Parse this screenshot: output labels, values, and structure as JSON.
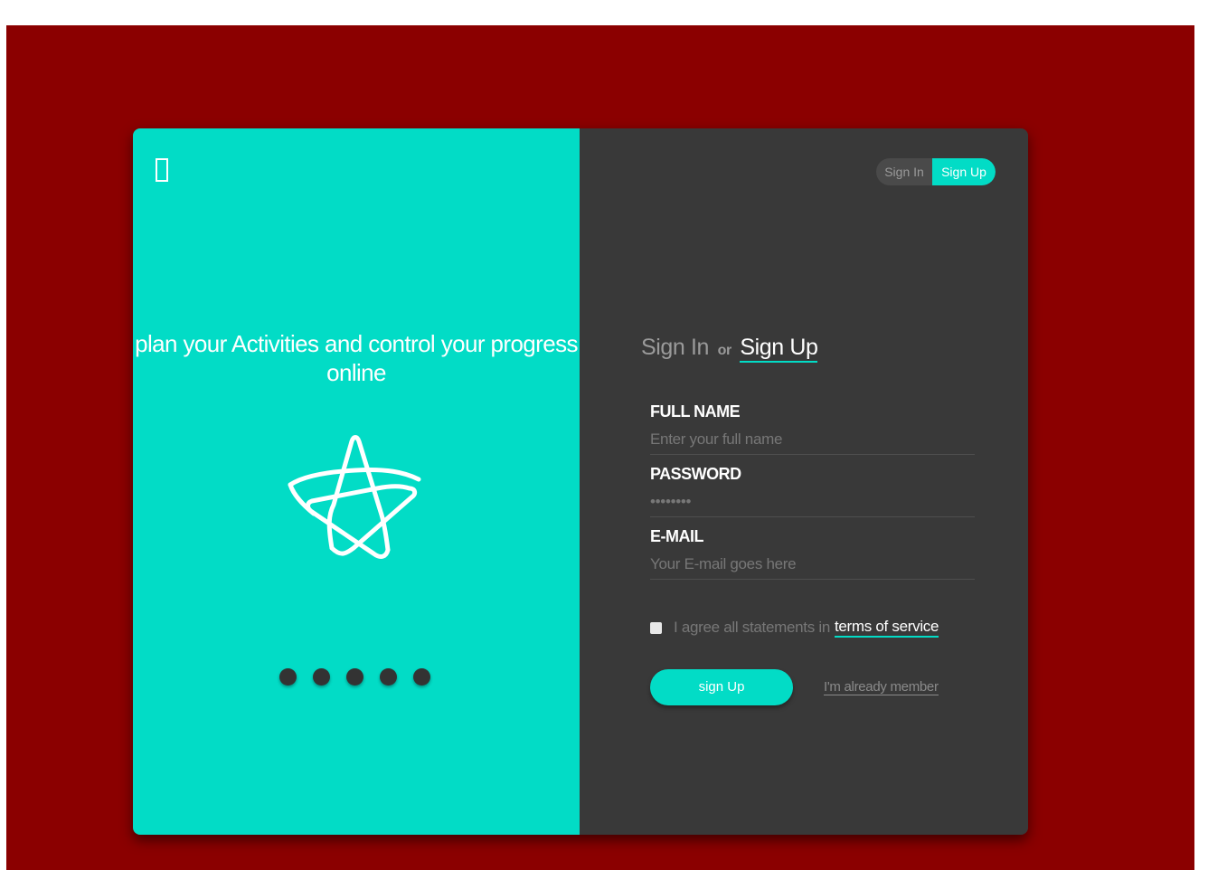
{
  "colors": {
    "page_background": "#8b0000",
    "accent": "#02dcc6",
    "panel_dark": "#393939"
  },
  "left_panel": {
    "logo_icon": "rectangle-outline-icon",
    "tagline": "plan your Activities and control your progress online",
    "illustration_icon": "star-icon",
    "dots_count": 5
  },
  "toggle": {
    "sign_in": "Sign In",
    "sign_up": "Sign Up",
    "active": "Sign Up"
  },
  "form": {
    "title_sign_in": "Sign In",
    "title_or": "or",
    "title_sign_up": "Sign Up",
    "full_name": {
      "label": "FULL NAME",
      "placeholder": "Enter your full name"
    },
    "password": {
      "label": "PASSWORD",
      "placeholder": "••••••••"
    },
    "email": {
      "label": "E-MAIL",
      "placeholder": "Your E-mail goes here"
    },
    "agree_text": "I agree all statements in",
    "terms_link": "terms of service",
    "submit_label": "sign Up",
    "member_link": "I'm already member"
  }
}
